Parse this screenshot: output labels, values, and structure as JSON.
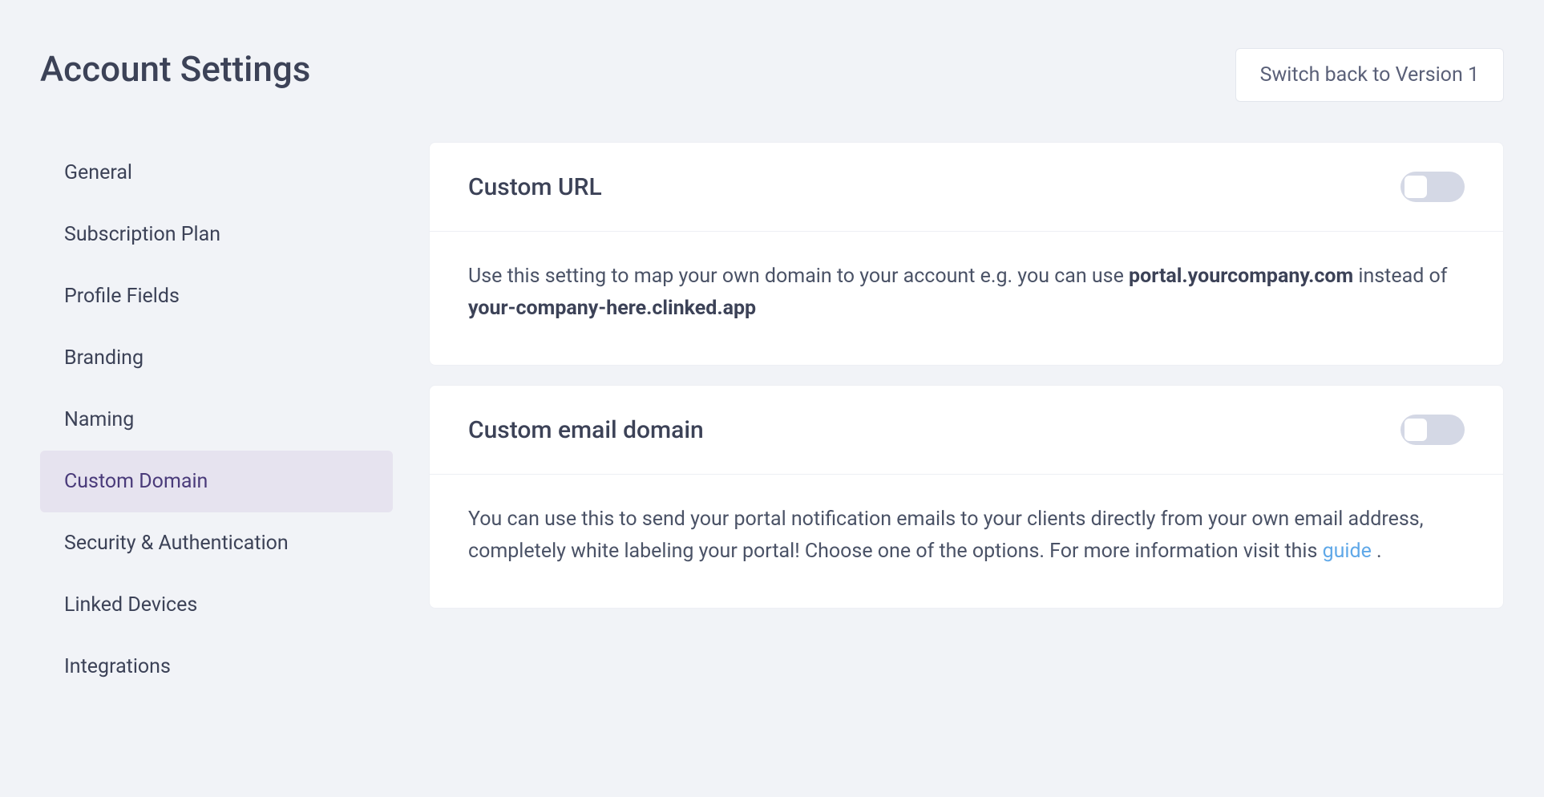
{
  "header": {
    "title": "Account Settings",
    "switch_back_label": "Switch back to Version 1"
  },
  "sidebar": {
    "items": [
      {
        "label": "General",
        "active": false
      },
      {
        "label": "Subscription Plan",
        "active": false
      },
      {
        "label": "Profile Fields",
        "active": false
      },
      {
        "label": "Branding",
        "active": false
      },
      {
        "label": "Naming",
        "active": false
      },
      {
        "label": "Custom Domain",
        "active": true
      },
      {
        "label": "Security & Authentication",
        "active": false
      },
      {
        "label": "Linked Devices",
        "active": false
      },
      {
        "label": "Integrations",
        "active": false
      }
    ]
  },
  "main": {
    "custom_url": {
      "title": "Custom URL",
      "toggle_on": false,
      "desc_prefix": "Use this setting to map your own domain to your account e.g. you can use ",
      "desc_bold1": "portal.yourcompany.com",
      "desc_middle": " instead of ",
      "desc_bold2": "your-company-here.clinked.app"
    },
    "custom_email": {
      "title": "Custom email domain",
      "toggle_on": false,
      "desc_text": "You can use this to send your portal notification emails to your clients directly from your own email address, completely white labeling your portal! Choose one of the options. For more information visit this ",
      "link_text": "guide",
      "desc_suffix": " ."
    }
  }
}
